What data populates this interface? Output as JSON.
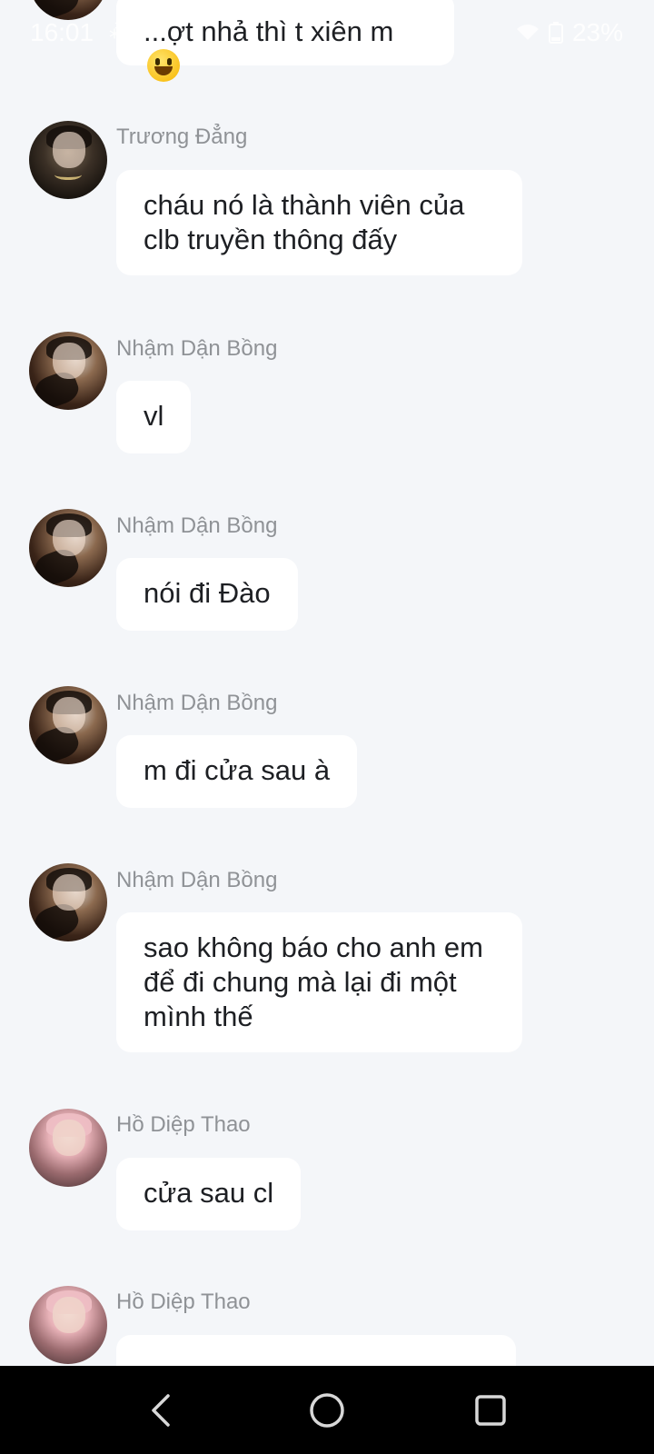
{
  "status_bar": {
    "time": "16:01",
    "extra": "⁂",
    "battery": "23%"
  },
  "messages": [
    {
      "sender": "",
      "text": "...ợt nhả thì t xiên m",
      "emoji": "grinning-face",
      "avatar": "avatar-nham"
    },
    {
      "sender": "Trương Đẳng",
      "text": "cháu nó là thành viên của clb truyền thông đấy",
      "avatar": "avatar-truong"
    },
    {
      "sender": "Nhậm Dận Bồng",
      "text": "vl",
      "avatar": "avatar-nham"
    },
    {
      "sender": "Nhậm Dận Bồng",
      "text": "nói đi Đào",
      "avatar": "avatar-nham"
    },
    {
      "sender": "Nhậm Dận Bồng",
      "text": "m đi cửa sau à",
      "avatar": "avatar-nham"
    },
    {
      "sender": "Nhậm Dận Bồng",
      "text": "sao không báo cho anh em để đi chung mà lại đi một mình thế",
      "avatar": "avatar-nham"
    },
    {
      "sender": "Hồ Diệp Thao",
      "text": "cửa sau cl",
      "avatar": "avatar-ho"
    },
    {
      "sender": "Hồ Diệp Thao",
      "text": "",
      "avatar": "avatar-ho"
    }
  ],
  "nav": {
    "back_icon": "back-icon",
    "home_icon": "home-icon",
    "recents_icon": "recents-icon"
  }
}
